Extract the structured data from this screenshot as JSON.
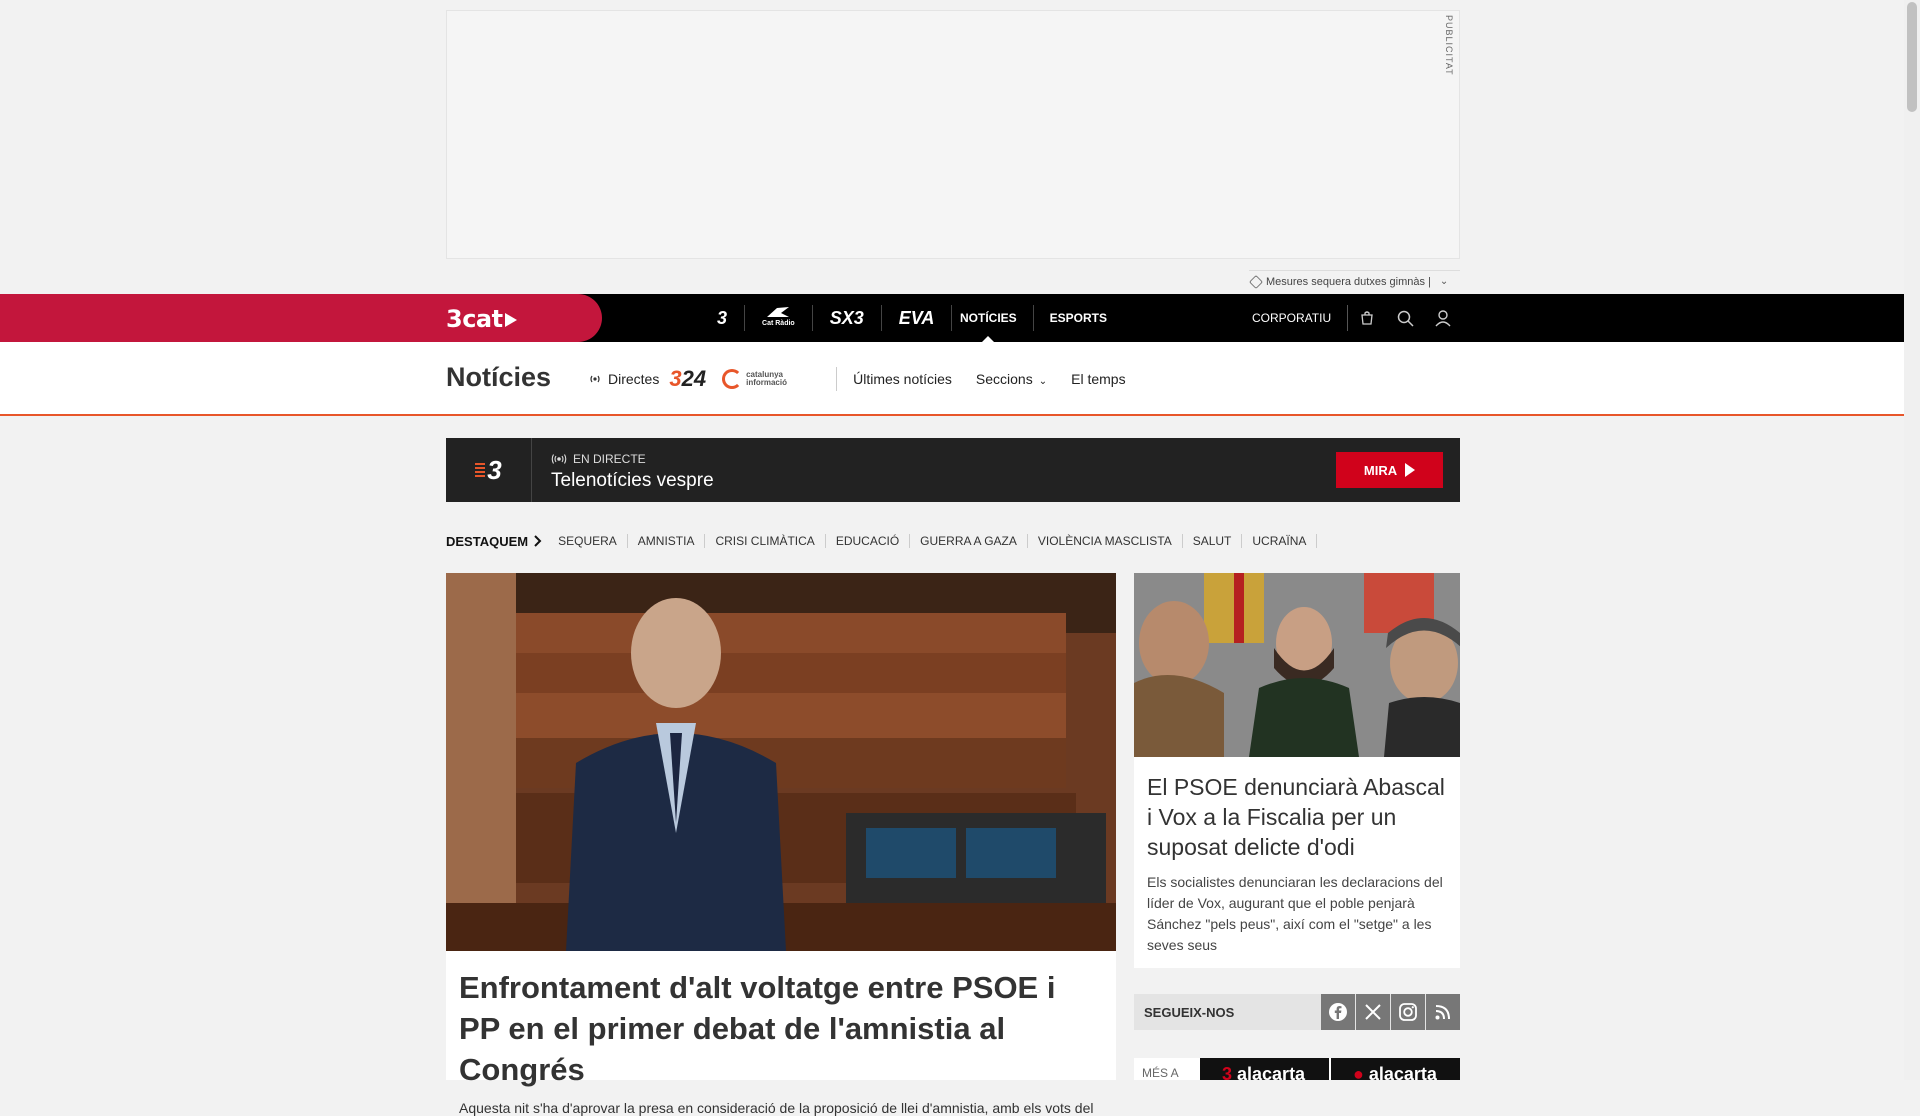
{
  "ad": {
    "label": "PUBLICITAT",
    "footer_text": "Mesures sequera dutxes gimnàs |"
  },
  "topbar": {
    "logo": "3cat",
    "brands": [
      "3",
      "Cat Ràdio",
      "SX3",
      "EVA"
    ],
    "nav": [
      "NOTÍCIES",
      "ESPORTS"
    ],
    "active_nav": "NOTÍCIES",
    "corporate": "CORPORATIU"
  },
  "section": {
    "title": "Notícies",
    "directes": "Directes",
    "logo_324": "324",
    "logo_ci": "catalunya informació",
    "links": {
      "latest": "Últimes notícies",
      "sections": "Seccions",
      "weather": "El temps"
    }
  },
  "live": {
    "channel": "3",
    "status": "EN DIRECTE",
    "program": "Telenotícies vespre",
    "button": "MIRA"
  },
  "tags": {
    "heading": "DESTAQUEM",
    "items": [
      "SEQUERA",
      "AMNISTIA",
      "CRISI CLIMÀTICA",
      "EDUCACIÓ",
      "GUERRA A GAZA",
      "VIOLÈNCIA MASCLISTA",
      "SALUT",
      "UCRAÏNA"
    ]
  },
  "main_article": {
    "title": "Enfrontament d'alt voltatge entre PSOE i PP en el primer debat de l'amnistia al Congrés",
    "summary": "Aquesta nit s'ha d'aprovar la presa en consideració de la proposició de llei d'amnistia, amb els vots del"
  },
  "side_article": {
    "title": "El PSOE denunciarà Abascal i Vox a la Fiscalia per un suposat delicte d'odi",
    "summary": "Els socialistes denunciaran les declaracions del líder de Vox, augurant que el poble penjarà Sánchez \"pels peus\", així com el \"setge\" a les seves seus"
  },
  "social": {
    "label": "SEGUEIX-NOS",
    "networks": [
      "facebook-icon",
      "x-icon",
      "instagram-icon",
      "rss-icon"
    ]
  },
  "alacarta": {
    "more": "MÉS A",
    "brand_a": "alacarta",
    "brand_b": "alacarta"
  },
  "colors": {
    "brand_red": "#c3163c",
    "accent_orange": "#e8562a",
    "button_red": "#d0021b"
  }
}
